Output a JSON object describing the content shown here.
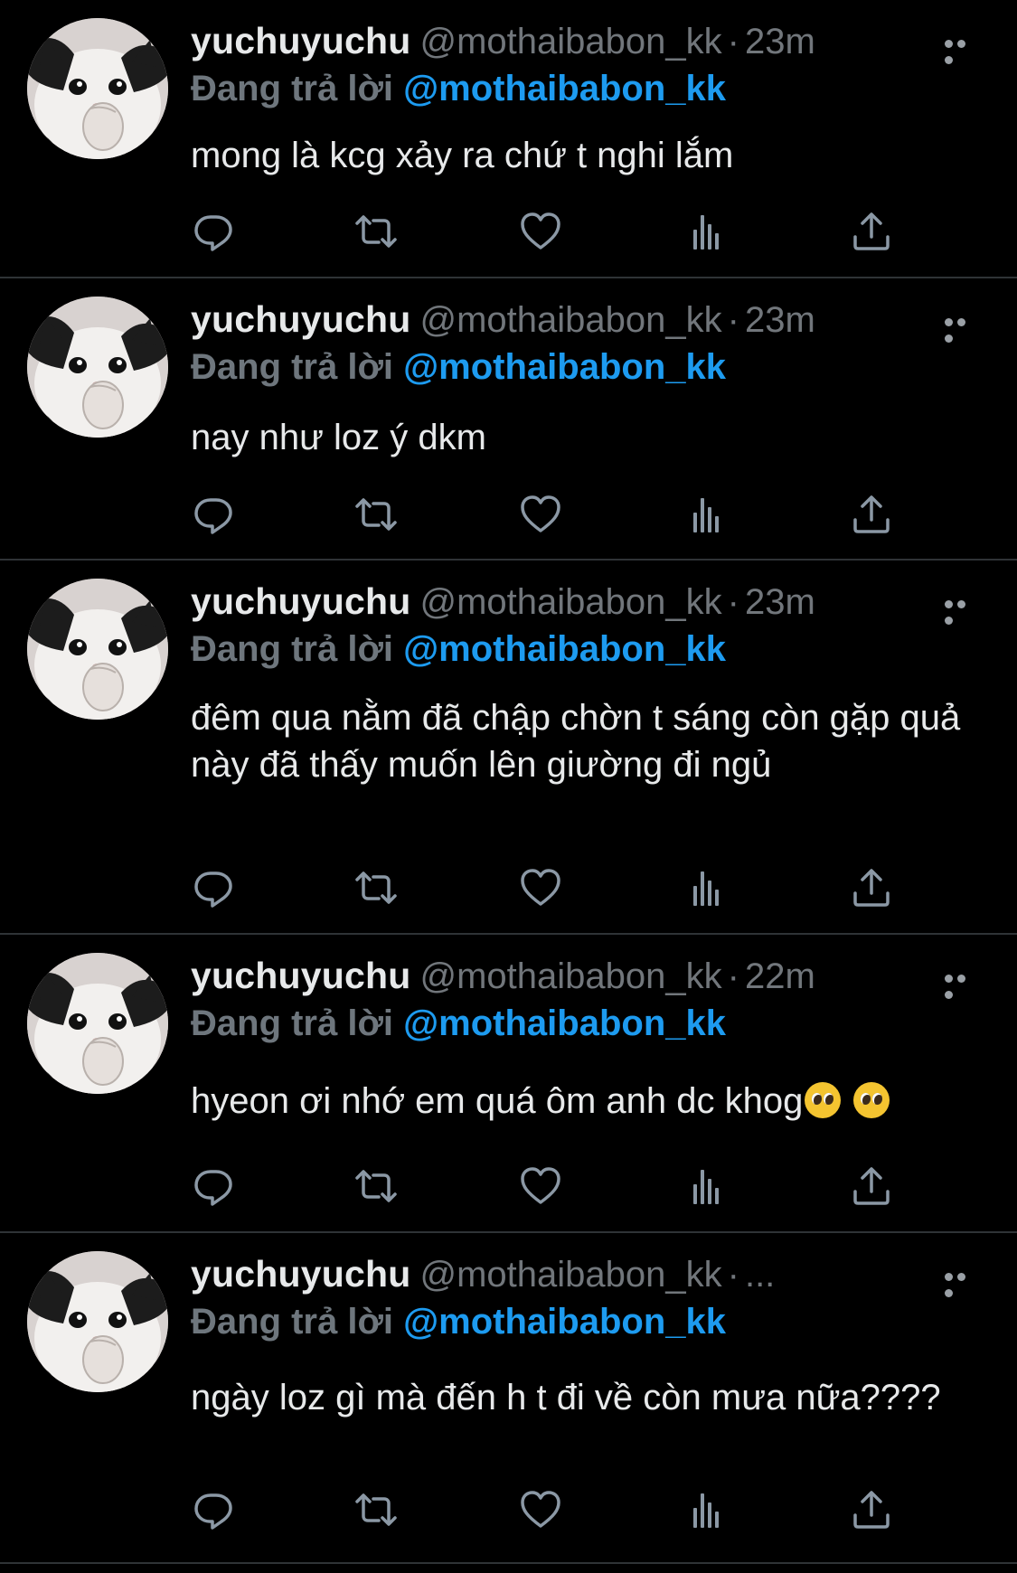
{
  "colors": {
    "background": "#000000",
    "divider": "#2f3336",
    "text": "#e7e9ea",
    "muted": "#71767b",
    "accent": "#1d9bf0",
    "icon": "#8b98a5"
  },
  "tweets": [
    {
      "name": "yuchuyuchu",
      "handle": "@mothaibabon_kk",
      "separator": "·",
      "time": "23m",
      "reply_label": "Đang trả lời",
      "reply_to": "@mothaibabon_kk",
      "text": "mong là kcg xảy ra chứ t nghi lắm",
      "emojis": []
    },
    {
      "name": "yuchuyuchu",
      "handle": "@mothaibabon_kk",
      "separator": "·",
      "time": "23m",
      "reply_label": "Đang trả lời",
      "reply_to": "@mothaibabon_kk",
      "text": "nay như loz ý dkm",
      "emojis": []
    },
    {
      "name": "yuchuyuchu",
      "handle": "@mothaibabon_kk",
      "separator": "·",
      "time": "23m",
      "reply_label": "Đang trả lời",
      "reply_to": "@mothaibabon_kk",
      "text": "đêm qua nằm đã chập chờn t sáng còn gặp quả này đã thấy muốn lên giường đi ngủ",
      "emojis": []
    },
    {
      "name": "yuchuyuchu",
      "handle": "@mothaibabon_kk",
      "separator": "·",
      "time": "22m",
      "reply_label": "Đang trả lời",
      "reply_to": "@mothaibabon_kk",
      "text": "hyeon ơi nhớ em quá ôm anh dc khog",
      "emojis": [
        "pleading-face-emoji",
        "pleading-face-emoji"
      ]
    },
    {
      "name": "yuchuyuchu",
      "handle": "@mothaibabon_kk",
      "separator": "·",
      "time": "...",
      "reply_label": "Đang trả lời",
      "reply_to": "@mothaibabon_kk",
      "text": "ngày loz gì mà đến h t đi về còn mưa nữa????",
      "emojis": []
    }
  ],
  "action_icons": [
    "reply-icon",
    "retweet-icon",
    "like-icon",
    "analytics-icon",
    "share-icon"
  ]
}
